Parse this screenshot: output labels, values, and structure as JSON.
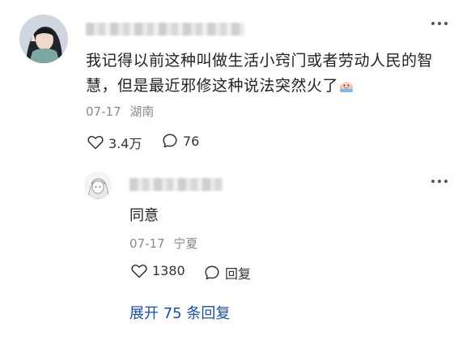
{
  "comment": {
    "text": "我记得以前这种叫做生活小窍门或者劳动人民的智慧，但是最近邪修这种说法突然火了",
    "date": "07-17",
    "location": "湖南",
    "likes": "3.4万",
    "replies": "76",
    "emoji_icon": "crying-emoji-icon"
  },
  "reply": {
    "text": "同意",
    "date": "07-17",
    "location": "宁夏",
    "likes": "1380",
    "reply_label": "回复"
  },
  "expand": {
    "label": "展开 75 条回复"
  },
  "colors": {
    "link": "#1c4fa0",
    "meta": "#8a8a8a",
    "text": "#222222"
  }
}
